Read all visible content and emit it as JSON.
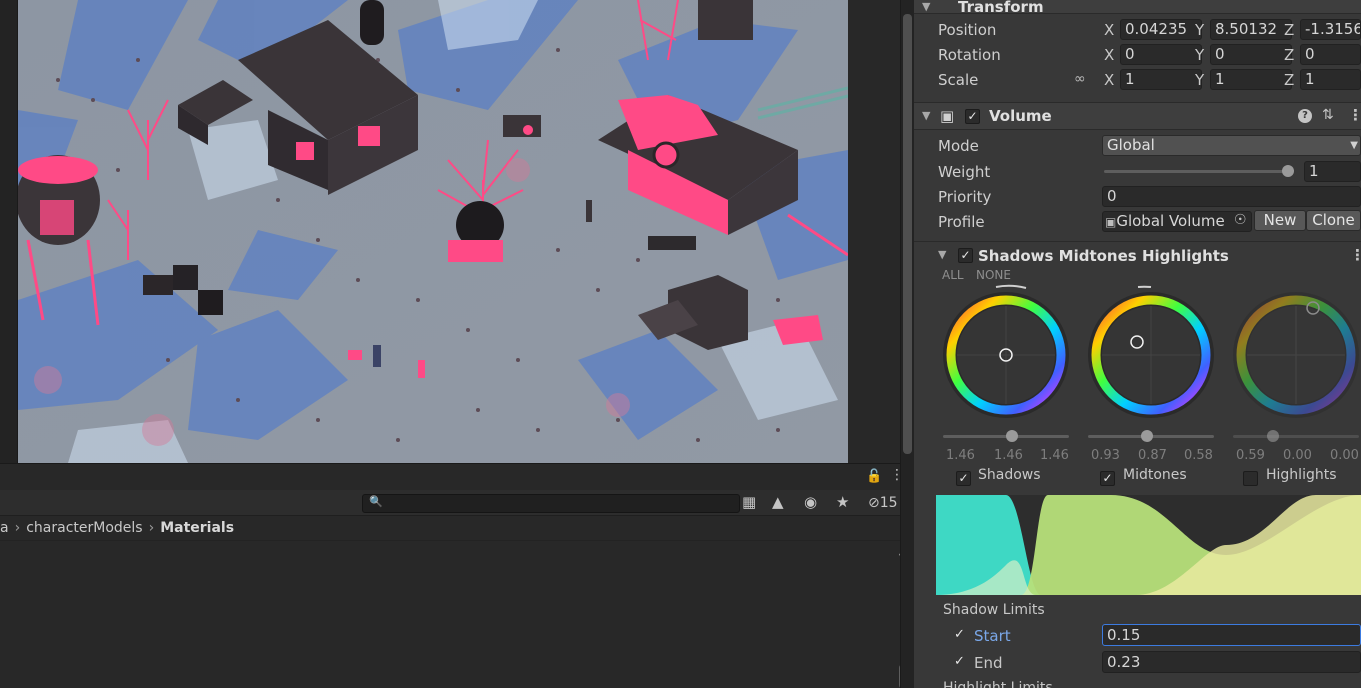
{
  "scene": {
    "description_hidden": ""
  },
  "project": {
    "search_placeholder": "",
    "hidden_count": "15",
    "breadcrumb": [
      "a",
      "characterModels",
      "Materials"
    ]
  },
  "inspector": {
    "transform": {
      "title": "Transform",
      "position": {
        "label": "Position",
        "x": "0.04235",
        "y": "8.50132",
        "z": "-1.3156"
      },
      "rotation": {
        "label": "Rotation",
        "x": "0",
        "y": "0",
        "z": "0"
      },
      "scale": {
        "label": "Scale",
        "x": "1",
        "y": "1",
        "z": "1"
      },
      "axis_x": "X",
      "axis_y": "Y",
      "axis_z": "Z"
    },
    "volume": {
      "title": "Volume",
      "enabled": true,
      "mode_label": "Mode",
      "mode_value": "Global",
      "weight_label": "Weight",
      "weight_value": "1",
      "weight_fraction": 1.0,
      "priority_label": "Priority",
      "priority_value": "0",
      "profile_label": "Profile",
      "profile_value": "Global Volume",
      "new_button": "New",
      "clone_button": "Clone"
    },
    "smh": {
      "title": "Shadows Midtones Highlights",
      "enabled": true,
      "all_label": "ALL",
      "none_label": "NONE",
      "wheels": [
        {
          "name": "Shadows",
          "checked": true,
          "values": [
            "1.46",
            "1.46",
            "1.46"
          ],
          "slider_fraction": 0.55
        },
        {
          "name": "Midtones",
          "checked": true,
          "values": [
            "0.93",
            "0.87",
            "0.58"
          ],
          "slider_fraction": 0.47
        },
        {
          "name": "Highlights",
          "checked": false,
          "values": [
            "0.59",
            "0.00",
            "0.00"
          ],
          "slider_fraction": 0.32
        }
      ],
      "shadow_limits_label": "Shadow Limits",
      "start_label": "Start",
      "start_value": "0.15",
      "end_label": "End",
      "end_value": "0.23",
      "highlight_limits_label": "Highlight Limits"
    },
    "colors": {
      "accent": "#7aa7e8",
      "shadows_curve": "#3ed8c4",
      "midtones_curve": "#b7e07a",
      "highlights_curve": "#e9eaa0"
    }
  }
}
